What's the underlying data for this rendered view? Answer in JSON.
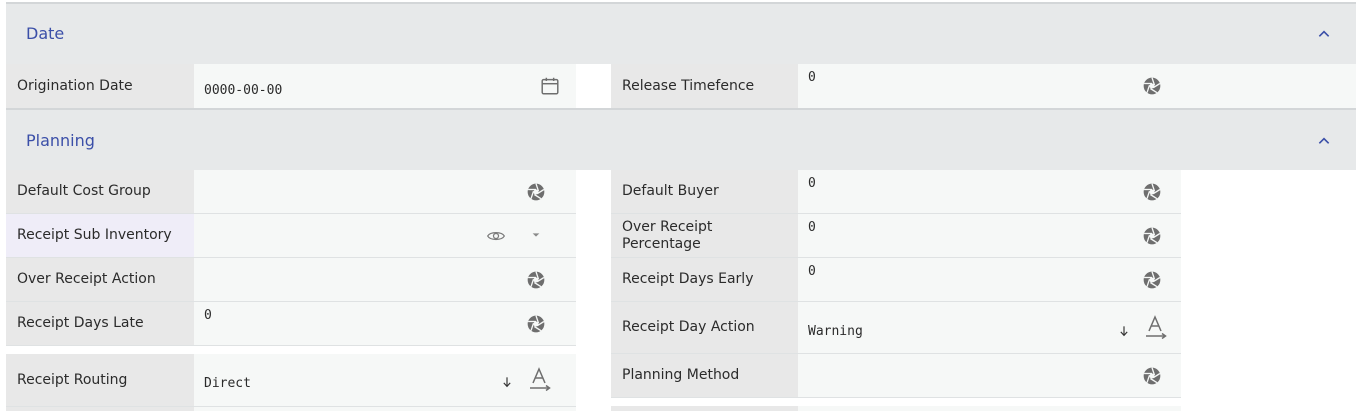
{
  "sections": {
    "date": {
      "title": "Date"
    },
    "planning": {
      "title": "Planning"
    }
  },
  "fields": {
    "origination_date": {
      "label": "Origination Date",
      "value": "0000-00-00"
    },
    "release_timefence": {
      "label": "Release Timefence",
      "value": "0"
    },
    "default_cost_group": {
      "label": "Default Cost Group",
      "value": ""
    },
    "default_buyer": {
      "label": "Default Buyer",
      "value": "0"
    },
    "receipt_sub_inventory": {
      "label": "Receipt Sub Inventory",
      "value": ""
    },
    "over_receipt_percentage": {
      "label": "Over Receipt Percentage",
      "value": "0"
    },
    "over_receipt_action": {
      "label": "Over Receipt Action",
      "value": ""
    },
    "receipt_days_early": {
      "label": "Receipt Days Early",
      "value": "0"
    },
    "receipt_days_late": {
      "label": "Receipt Days Late",
      "value": "0"
    },
    "receipt_day_action": {
      "label": "Receipt Day Action",
      "value": "Warning"
    },
    "receipt_routing": {
      "label": "Receipt Routing",
      "value": "Direct"
    },
    "planning_method": {
      "label": "Planning Method",
      "value": ""
    }
  },
  "icons": {
    "calendar": "calendar-icon",
    "aperture": "aperture-icon",
    "eye": "eye-icon",
    "dropdown": "caret-down-icon",
    "sort": "arrow-down-icon",
    "text_format": "text-format-icon",
    "collapse": "chevron-up-icon"
  },
  "colors": {
    "section_title": "#3b4fa8",
    "label_bg": "#e8e8e8",
    "value_bg": "#f6f8f7",
    "header_bg": "#e7e9ea"
  }
}
